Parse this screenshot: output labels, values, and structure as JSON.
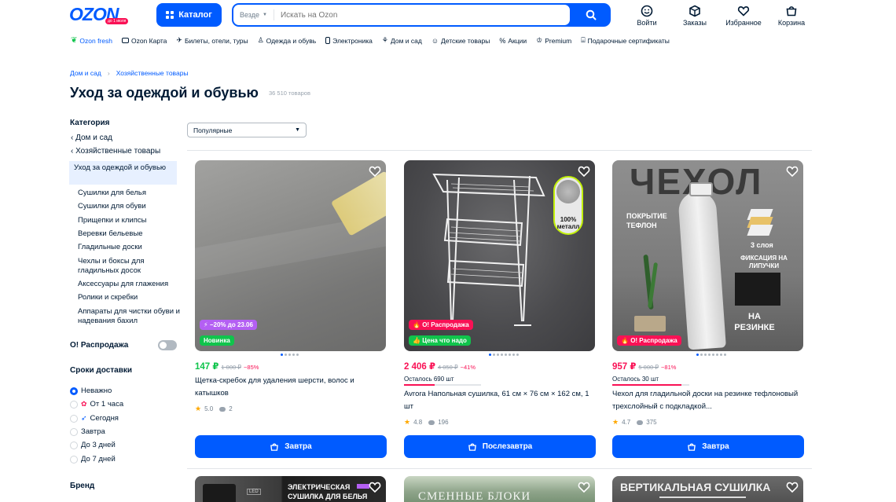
{
  "header": {
    "logo": "OZON",
    "logo_badge": "до 1 июля",
    "catalog_label": "Каталог",
    "search_scope": "Везде",
    "search_placeholder": "Искать на Ozon",
    "actions": [
      {
        "label": "Войти",
        "icon": "face-icon"
      },
      {
        "label": "Заказы",
        "icon": "box-icon"
      },
      {
        "label": "Избранное",
        "icon": "heart-icon"
      },
      {
        "label": "Корзина",
        "icon": "cart-icon"
      }
    ]
  },
  "nav": [
    {
      "label": "Ozon fresh",
      "accent": true
    },
    {
      "label": "Ozon Карта"
    },
    {
      "label": "Билеты, отели, туры"
    },
    {
      "label": "Одежда и обувь"
    },
    {
      "label": "Электроника"
    },
    {
      "label": "Дом и сад"
    },
    {
      "label": "Детские товары"
    },
    {
      "label": "Акции"
    },
    {
      "label": "Premium"
    },
    {
      "label": "Подарочные сертификаты"
    }
  ],
  "breadcrumb": [
    "Дом и сад",
    "Хозяйственные товары"
  ],
  "page": {
    "title": "Уход за одеждой и обувью",
    "count": "36 510 товаров"
  },
  "sidebar": {
    "category_heading": "Категория",
    "parents": [
      "Дом и сад",
      "Хозяйственные товары"
    ],
    "active": "Уход за одеждой и обувью",
    "subs": [
      "Сушилки для белья",
      "Сушилки для обуви",
      "Прищепки и клипсы",
      "Веревки бельевые",
      "Гладильные доски",
      "Чехлы и боксы для гладильных досок",
      "Аксессуары для глажения",
      "Ролики и скребки",
      "Аппараты для чистки обуви и надевания бахил"
    ],
    "sale_label": "О! Распродажа",
    "delivery_heading": "Сроки доставки",
    "delivery": [
      "Неважно",
      "От 1 часа",
      "Сегодня",
      "Завтра",
      "До 3 дней",
      "До 7 дней"
    ],
    "brand_heading": "Бренд"
  },
  "sort": {
    "selected": "Популярные"
  },
  "products": [
    {
      "tags": [
        "−20% до 23.06",
        "Новинка"
      ],
      "price": "147 ₽",
      "old": "1 000 ₽",
      "discount": "−85%",
      "title": "Щетка-скребок для удаления шерсти, волос и катышков",
      "rating": "5.0",
      "reviews": "2",
      "button": "Завтра"
    },
    {
      "tags": [
        "О! Распродажа",
        "Цена что надо"
      ],
      "image_text": "100% металл",
      "price": "2 406 ₽",
      "old": "4 050 ₽",
      "discount": "−41%",
      "left": "Осталось 690 шт",
      "left_fraction": 0.4,
      "title": "Avrora Напольная сушилка, 61 см × 76 см × 162 см, 1 шт",
      "rating": "4.8",
      "reviews": "196",
      "button": "Послезавтра"
    },
    {
      "tags": [
        "О! Распродажа"
      ],
      "image_texts": [
        "ЧЕХОЛ",
        "ПОКРЫТИЕ ТЕФЛОН",
        "3 слоя",
        "ФИКСАЦИЯ НА ЛИПУЧКИ",
        "НА РЕЗИНКЕ"
      ],
      "price": "957 ₽",
      "old": "5 000 ₽",
      "discount": "−81%",
      "left": "Осталось 30 шт",
      "left_fraction": 0.9,
      "title": "Чехол для гладильной доски на резинке тефлоновый трехслойный с подкладкой...",
      "rating": "4.7",
      "reviews": "375",
      "button": "Завтра"
    }
  ],
  "bottom_row": [
    {
      "image_text": "ЭЛЕКТРИЧЕСКАЯ СУШИЛКА ДЛЯ БЕЛЬЯ",
      "display": "LED"
    },
    {
      "image_text": "СМЕННЫЕ БЛОКИ"
    },
    {
      "image_text": "ВЕРТИКАЛЬНАЯ СУШИЛКА"
    }
  ],
  "colors": {
    "brand": "#005bff",
    "sale": "#f91155",
    "green": "#10c44c"
  }
}
